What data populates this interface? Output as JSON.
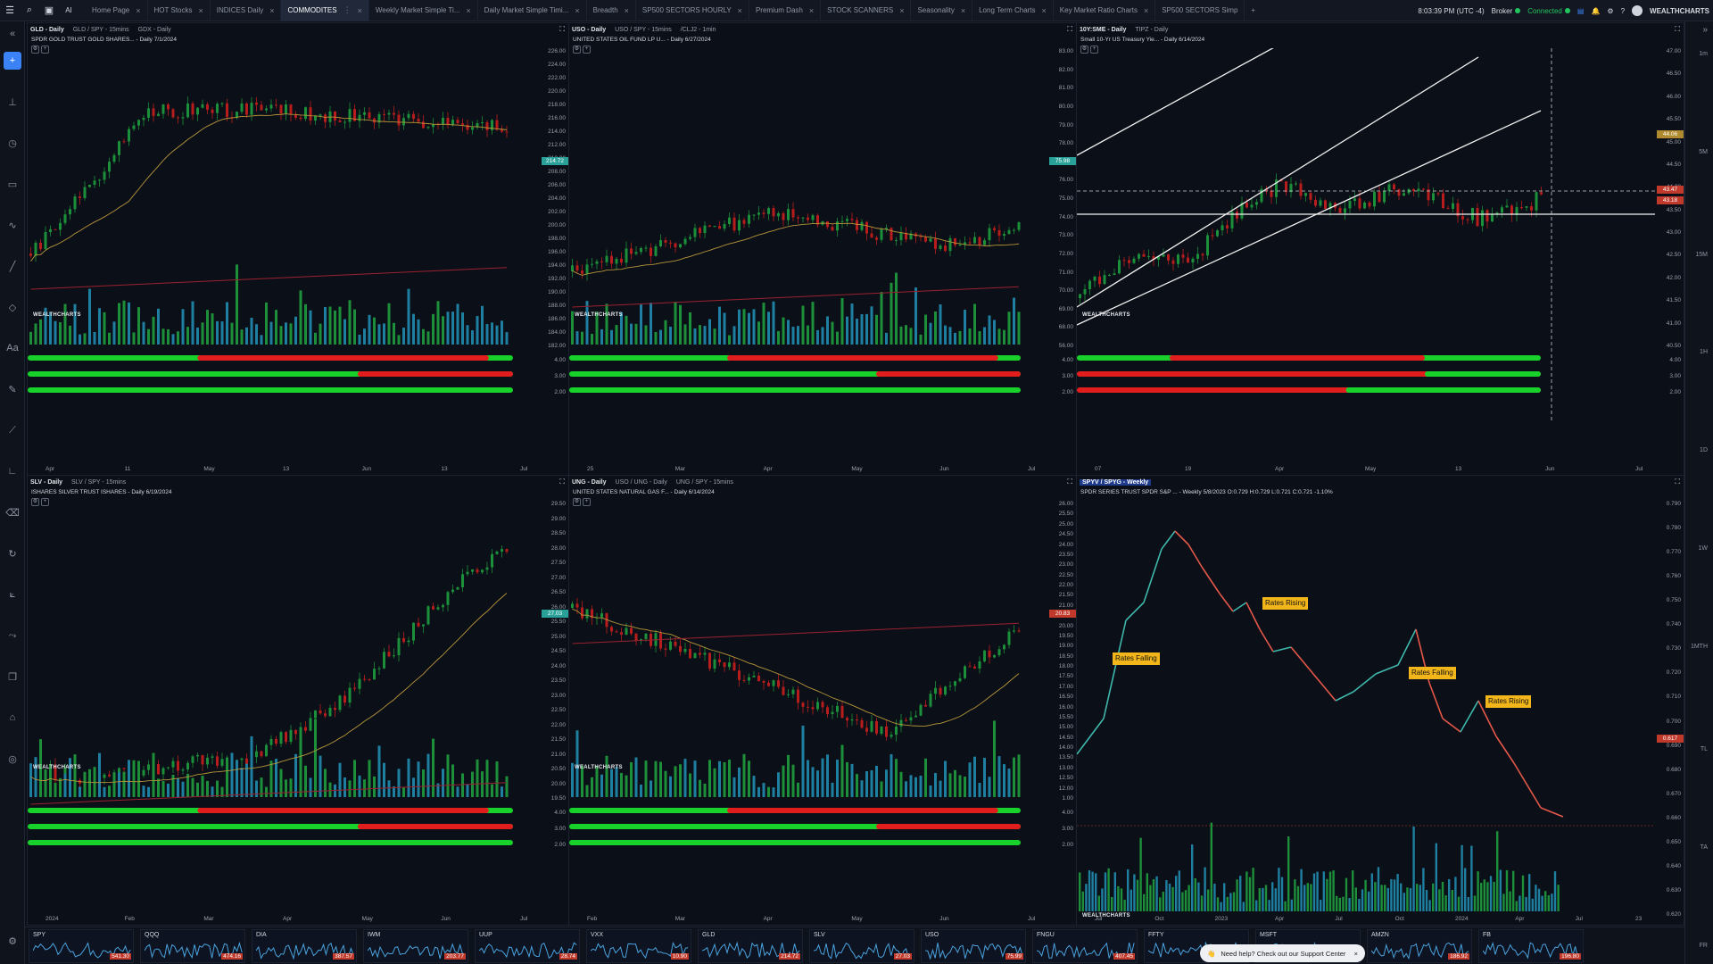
{
  "topbar": {
    "tabs": [
      {
        "label": "Home Page"
      },
      {
        "label": "HOT Stocks"
      },
      {
        "label": "INDICES Daily"
      },
      {
        "label": "COMMODITES"
      },
      {
        "label": "Weekly Market Simple Ti..."
      },
      {
        "label": "Daily Market Simple Timi..."
      },
      {
        "label": "Breadth"
      },
      {
        "label": "SP500 SECTORS HOURLY"
      },
      {
        "label": "Premium Dash"
      },
      {
        "label": "STOCK SCANNERS"
      },
      {
        "label": "Seasonality"
      },
      {
        "label": "Long Term Charts"
      },
      {
        "label": "Key Market Ratio Charts"
      },
      {
        "label": "SP500 SECTORS Simp"
      }
    ],
    "time": "8:03:39 PM (UTC -4)",
    "broker": "Broker",
    "connected": "Connected",
    "brand": "WEALTHCHARTS",
    "ai": "AI"
  },
  "right_intervals": [
    "1m",
    "5M",
    "15M",
    "1H",
    "1D",
    "1W",
    "1MTH",
    "TL",
    "TA",
    "FR"
  ],
  "panels": [
    {
      "tabs": [
        "GLD - Daily",
        "GLD / SPY - 15mins",
        "GDX - Daily"
      ],
      "title": "SPDR GOLD TRUST GOLD SHARES... - Daily 7/1/2024",
      "yticks": [
        "226.00",
        "224.00",
        "222.00",
        "220.00",
        "218.00",
        "216.00",
        "214.00",
        "212.00",
        "210.00",
        "208.00",
        "206.00",
        "204.00",
        "202.00",
        "200.00",
        "198.00",
        "196.00",
        "194.00",
        "192.00",
        "190.00",
        "188.00",
        "186.00",
        "184.00",
        "182.00"
      ],
      "price": "214.72",
      "xticks": [
        "Apr",
        "11",
        "May",
        "13",
        "Jun",
        "13",
        "Jul"
      ],
      "indicators": [
        "4.00",
        "3.00",
        "2.00"
      ]
    },
    {
      "tabs": [
        "USO - Daily",
        "USO / SPY - 15mins",
        "/CLJ2 - 1min"
      ],
      "title": "UNITED STATES OIL FUND LP U... - Daily 6/27/2024",
      "yticks": [
        "83.00",
        "82.00",
        "81.00",
        "80.00",
        "79.00",
        "78.00",
        "77.00",
        "76.00",
        "75.00",
        "74.00",
        "73.00",
        "72.00",
        "71.00",
        "70.00",
        "69.00",
        "68.00",
        "56.00"
      ],
      "price": "75.98",
      "xticks": [
        "25",
        "Mar",
        "Apr",
        "May",
        "Jun",
        "Jul"
      ],
      "indicators": [
        "4.00",
        "3.00",
        "2.00"
      ]
    },
    {
      "tabs": [
        "10Y:SME - Daily",
        "TIPZ - Daily"
      ],
      "title": "Small 10-Yr US Treasury Yie... - Daily 6/14/2024",
      "yticks": [
        "47.00",
        "46.50",
        "46.00",
        "45.50",
        "45.00",
        "44.50",
        "44.00",
        "43.50",
        "43.00",
        "42.50",
        "42.00",
        "41.50",
        "41.00",
        "40.50"
      ],
      "price_hi": "44.06",
      "price_lo": "43.47",
      "price_lo2": "43.18",
      "xticks": [
        "07",
        "19",
        "Apr",
        "May",
        "13",
        "Jun",
        "Jul"
      ],
      "indicators": [
        "4.00",
        "3.00",
        "2.00"
      ]
    },
    {
      "tabs": [
        "SLV - Daily",
        "SLV / SPY - 15mins"
      ],
      "title": "ISHARES SILVER TRUST ISHARES - Daily 6/19/2024",
      "yticks": [
        "29.50",
        "29.00",
        "28.50",
        "28.00",
        "27.50",
        "27.00",
        "26.50",
        "26.00",
        "25.50",
        "25.00",
        "24.50",
        "24.00",
        "23.50",
        "23.00",
        "22.50",
        "22.00",
        "21.50",
        "21.00",
        "20.50",
        "20.00",
        "19.50"
      ],
      "price": "27.03",
      "xticks": [
        "2024",
        "Feb",
        "Mar",
        "Apr",
        "May",
        "Jun",
        "Jul"
      ],
      "indicators": [
        "4.00",
        "3.00",
        "2.00"
      ]
    },
    {
      "tabs": [
        "UNG - Daily",
        "USO / UNG - Daily",
        "UNG / SPY - 15mins"
      ],
      "title": "UNITED STATES NATURAL GAS F... - Daily 6/14/2024",
      "yticks": [
        "26.00",
        "25.50",
        "25.00",
        "24.50",
        "24.00",
        "23.50",
        "23.00",
        "22.50",
        "22.00",
        "21.50",
        "21.00",
        "20.50",
        "20.00",
        "19.50",
        "19.00",
        "18.50",
        "18.00",
        "17.50",
        "17.00",
        "16.50",
        "16.00",
        "15.50",
        "15.00",
        "14.50",
        "14.00",
        "13.50",
        "13.00",
        "12.50",
        "12.00",
        "1.00"
      ],
      "price": "20.83",
      "xticks": [
        "Feb",
        "Mar",
        "Apr",
        "May",
        "Jun",
        "Jul"
      ],
      "indicators": [
        "4.00",
        "3.00",
        "2.00"
      ]
    },
    {
      "tabs": [
        "SPYV / SPYG - Weekly"
      ],
      "title": "SPDR SERIES TRUST SPDR S&P ... - Weekly 5/8/2023 O:0.729 H:0.729 L:0.721 C:0.721 -1.10%",
      "yticks": [
        "0.790",
        "0.780",
        "0.770",
        "0.760",
        "0.750",
        "0.740",
        "0.730",
        "0.720",
        "0.710",
        "0.700",
        "0.690",
        "0.680",
        "0.670",
        "0.660",
        "0.650",
        "0.640",
        "0.630",
        "0.620"
      ],
      "price": "0.617",
      "xticks": [
        "Jul",
        "Oct",
        "2023",
        "Apr",
        "Jul",
        "Oct",
        "2024",
        "Apr",
        "Jul",
        "23"
      ],
      "annotations": [
        "Rates Falling",
        "Rates Rising",
        "Rates Falling",
        "Rates Rising"
      ]
    }
  ],
  "watchlist": [
    {
      "sym": "SPY",
      "price": "541.30"
    },
    {
      "sym": "QQQ",
      "price": "474.16"
    },
    {
      "sym": "DIA",
      "price": "387.57"
    },
    {
      "sym": "IWM",
      "price": "203.77"
    },
    {
      "sym": "UUP",
      "price": "28.74"
    },
    {
      "sym": "VXX",
      "price": "10.90"
    },
    {
      "sym": "GLD",
      "price": "214.72"
    },
    {
      "sym": "SLV",
      "price": "27.03"
    },
    {
      "sym": "USO",
      "price": "75.99"
    },
    {
      "sym": "FNGU",
      "price": "407.45"
    },
    {
      "sym": "FFTY",
      "price": ""
    },
    {
      "sym": "MSFT",
      "price": ""
    },
    {
      "sym": "AMZN",
      "price": "186.92"
    },
    {
      "sym": "FB",
      "price": "196.80"
    }
  ],
  "support_text": "Need help? Check out our Support Center",
  "colors": {
    "green": "#22c55e",
    "red": "#ef4444",
    "teal": "#2aa198",
    "bull": "#1b8f3a",
    "bear": "#b81d1d"
  }
}
